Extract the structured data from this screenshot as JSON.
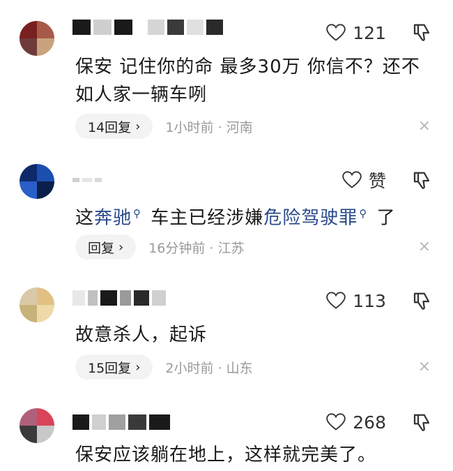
{
  "comments": [
    {
      "likes": "121",
      "text_parts": [
        "保安 记住你的命 最多30万 你信不？还不如人家一辆车咧"
      ],
      "reply_label": "14回复",
      "time": "1小时前 · 河南",
      "avatar_colors": [
        "#7a1f1f",
        "#a85a4a",
        "#6e3a3a",
        "#c9a27e"
      ],
      "name_blocks": [
        "#1a1a1a",
        "#cfcfcf",
        "#1a1a1a",
        "#ffffff",
        "#d6d6d6",
        "#3a3a3a",
        "#e0e0e0",
        "#2a2a2a"
      ]
    },
    {
      "likes": "赞",
      "text_before": "这",
      "link1": "奔驰",
      "text_middle": " 车主已经涉嫌",
      "link2": "危险驾驶罪",
      "text_after": " 了",
      "reply_label": "回复",
      "time": "16分钟前 · 江苏",
      "avatar_colors": [
        "#0e2a6a",
        "#1c4fb0",
        "#2a5ec8",
        "#0a1f4a"
      ],
      "name_blocks": [
        "#cfcfcf",
        "#e6e6e6",
        "#d9d9d9"
      ]
    },
    {
      "likes": "113",
      "text_parts": [
        "故意杀人，起诉"
      ],
      "reply_label": "15回复",
      "time": "2小时前 · 山东",
      "avatar_colors": [
        "#d9c9a8",
        "#e2c084",
        "#c8b27a",
        "#efd9a9"
      ],
      "name_blocks": [
        "#e8e8e8",
        "#c0c0c0",
        "#1a1a1a",
        "#9a9a9a",
        "#2a2a2a",
        "#cfcfcf"
      ]
    },
    {
      "likes": "268",
      "text_parts": [
        "保安应该躺在地上，这样就完美了。"
      ],
      "avatar_colors": [
        "#b0607a",
        "#d9445a",
        "#3a3a3a",
        "#c8c8c8"
      ],
      "name_blocks": [
        "#1a1a1a",
        "#cfcfcf",
        "#a0a0a0",
        "#3a3a3a",
        "#1a1a1a"
      ]
    }
  ],
  "icons": {
    "heart": "heart-outline-icon",
    "dislike": "thumb-down-icon",
    "close": "close-icon",
    "search": "search-icon"
  },
  "close_glyph": "×",
  "chevron_glyph": "›"
}
